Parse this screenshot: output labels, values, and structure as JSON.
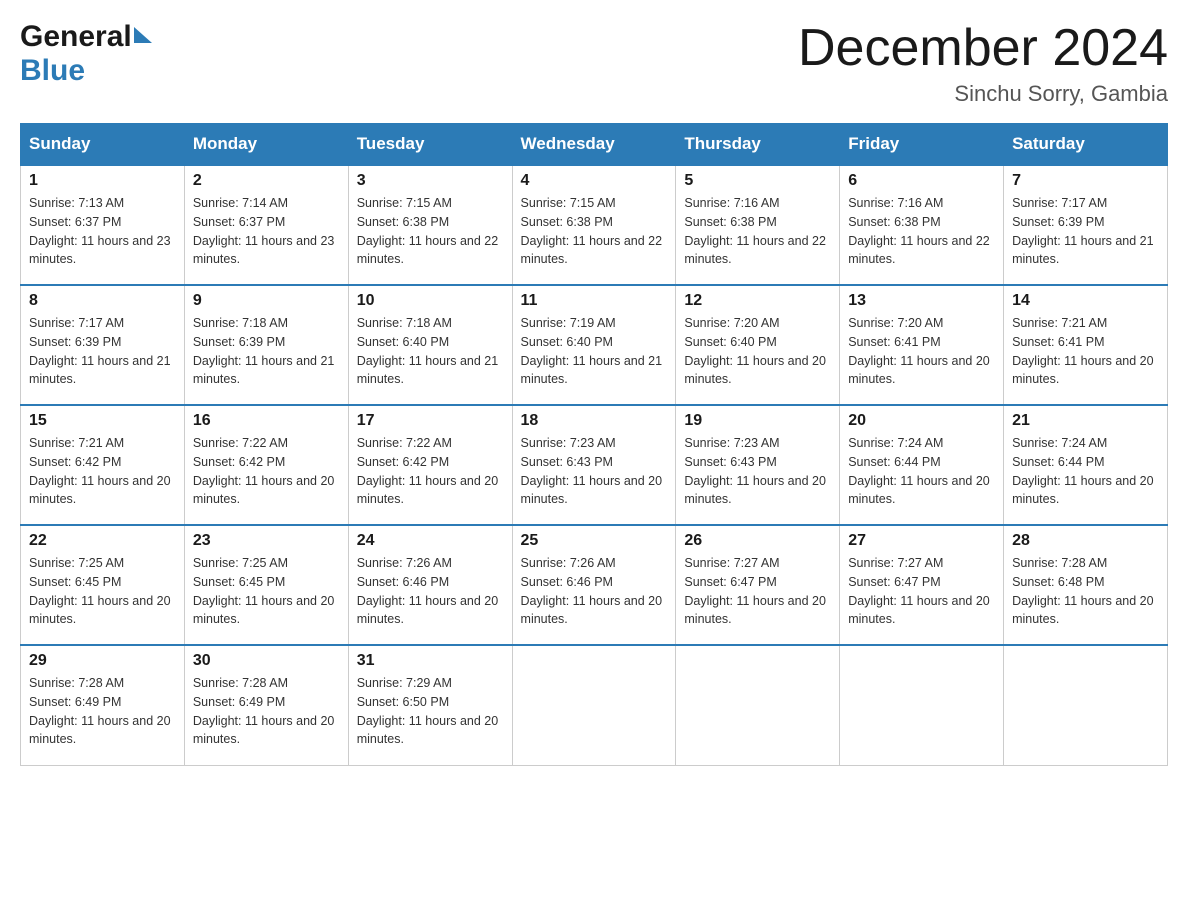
{
  "header": {
    "month_title": "December 2024",
    "location": "Sinchu Sorry, Gambia"
  },
  "logo": {
    "general": "General",
    "blue": "Blue"
  },
  "days_of_week": [
    "Sunday",
    "Monday",
    "Tuesday",
    "Wednesday",
    "Thursday",
    "Friday",
    "Saturday"
  ],
  "weeks": [
    [
      {
        "day": "1",
        "sunrise": "7:13 AM",
        "sunset": "6:37 PM",
        "daylight": "11 hours and 23 minutes."
      },
      {
        "day": "2",
        "sunrise": "7:14 AM",
        "sunset": "6:37 PM",
        "daylight": "11 hours and 23 minutes."
      },
      {
        "day": "3",
        "sunrise": "7:15 AM",
        "sunset": "6:38 PM",
        "daylight": "11 hours and 22 minutes."
      },
      {
        "day": "4",
        "sunrise": "7:15 AM",
        "sunset": "6:38 PM",
        "daylight": "11 hours and 22 minutes."
      },
      {
        "day": "5",
        "sunrise": "7:16 AM",
        "sunset": "6:38 PM",
        "daylight": "11 hours and 22 minutes."
      },
      {
        "day": "6",
        "sunrise": "7:16 AM",
        "sunset": "6:38 PM",
        "daylight": "11 hours and 22 minutes."
      },
      {
        "day": "7",
        "sunrise": "7:17 AM",
        "sunset": "6:39 PM",
        "daylight": "11 hours and 21 minutes."
      }
    ],
    [
      {
        "day": "8",
        "sunrise": "7:17 AM",
        "sunset": "6:39 PM",
        "daylight": "11 hours and 21 minutes."
      },
      {
        "day": "9",
        "sunrise": "7:18 AM",
        "sunset": "6:39 PM",
        "daylight": "11 hours and 21 minutes."
      },
      {
        "day": "10",
        "sunrise": "7:18 AM",
        "sunset": "6:40 PM",
        "daylight": "11 hours and 21 minutes."
      },
      {
        "day": "11",
        "sunrise": "7:19 AM",
        "sunset": "6:40 PM",
        "daylight": "11 hours and 21 minutes."
      },
      {
        "day": "12",
        "sunrise": "7:20 AM",
        "sunset": "6:40 PM",
        "daylight": "11 hours and 20 minutes."
      },
      {
        "day": "13",
        "sunrise": "7:20 AM",
        "sunset": "6:41 PM",
        "daylight": "11 hours and 20 minutes."
      },
      {
        "day": "14",
        "sunrise": "7:21 AM",
        "sunset": "6:41 PM",
        "daylight": "11 hours and 20 minutes."
      }
    ],
    [
      {
        "day": "15",
        "sunrise": "7:21 AM",
        "sunset": "6:42 PM",
        "daylight": "11 hours and 20 minutes."
      },
      {
        "day": "16",
        "sunrise": "7:22 AM",
        "sunset": "6:42 PM",
        "daylight": "11 hours and 20 minutes."
      },
      {
        "day": "17",
        "sunrise": "7:22 AM",
        "sunset": "6:42 PM",
        "daylight": "11 hours and 20 minutes."
      },
      {
        "day": "18",
        "sunrise": "7:23 AM",
        "sunset": "6:43 PM",
        "daylight": "11 hours and 20 minutes."
      },
      {
        "day": "19",
        "sunrise": "7:23 AM",
        "sunset": "6:43 PM",
        "daylight": "11 hours and 20 minutes."
      },
      {
        "day": "20",
        "sunrise": "7:24 AM",
        "sunset": "6:44 PM",
        "daylight": "11 hours and 20 minutes."
      },
      {
        "day": "21",
        "sunrise": "7:24 AM",
        "sunset": "6:44 PM",
        "daylight": "11 hours and 20 minutes."
      }
    ],
    [
      {
        "day": "22",
        "sunrise": "7:25 AM",
        "sunset": "6:45 PM",
        "daylight": "11 hours and 20 minutes."
      },
      {
        "day": "23",
        "sunrise": "7:25 AM",
        "sunset": "6:45 PM",
        "daylight": "11 hours and 20 minutes."
      },
      {
        "day": "24",
        "sunrise": "7:26 AM",
        "sunset": "6:46 PM",
        "daylight": "11 hours and 20 minutes."
      },
      {
        "day": "25",
        "sunrise": "7:26 AM",
        "sunset": "6:46 PM",
        "daylight": "11 hours and 20 minutes."
      },
      {
        "day": "26",
        "sunrise": "7:27 AM",
        "sunset": "6:47 PM",
        "daylight": "11 hours and 20 minutes."
      },
      {
        "day": "27",
        "sunrise": "7:27 AM",
        "sunset": "6:47 PM",
        "daylight": "11 hours and 20 minutes."
      },
      {
        "day": "28",
        "sunrise": "7:28 AM",
        "sunset": "6:48 PM",
        "daylight": "11 hours and 20 minutes."
      }
    ],
    [
      {
        "day": "29",
        "sunrise": "7:28 AM",
        "sunset": "6:49 PM",
        "daylight": "11 hours and 20 minutes."
      },
      {
        "day": "30",
        "sunrise": "7:28 AM",
        "sunset": "6:49 PM",
        "daylight": "11 hours and 20 minutes."
      },
      {
        "day": "31",
        "sunrise": "7:29 AM",
        "sunset": "6:50 PM",
        "daylight": "11 hours and 20 minutes."
      },
      null,
      null,
      null,
      null
    ]
  ]
}
